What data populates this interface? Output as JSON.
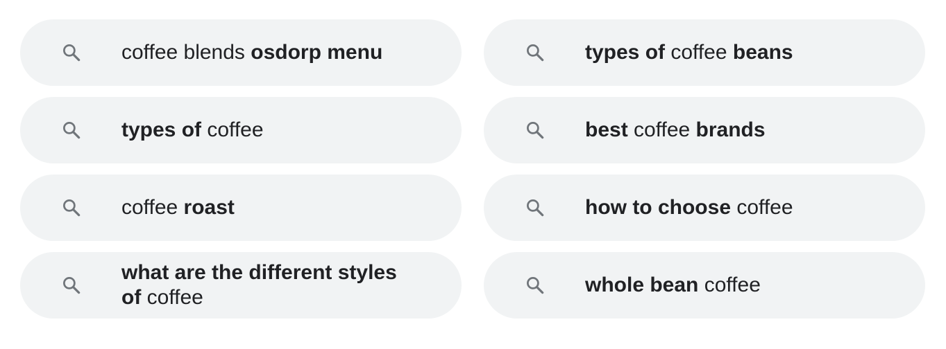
{
  "suggestions": [
    {
      "icon": "search-icon",
      "segments": [
        {
          "text": "coffee blends ",
          "bold": false
        },
        {
          "text": "osdorp menu",
          "bold": true
        }
      ]
    },
    {
      "icon": "search-icon",
      "segments": [
        {
          "text": "types of",
          "bold": true
        },
        {
          "text": " coffee ",
          "bold": false
        },
        {
          "text": "beans",
          "bold": true
        }
      ]
    },
    {
      "icon": "search-icon",
      "segments": [
        {
          "text": "types of",
          "bold": true
        },
        {
          "text": " coffee",
          "bold": false
        }
      ]
    },
    {
      "icon": "search-icon",
      "segments": [
        {
          "text": "best",
          "bold": true
        },
        {
          "text": " coffee ",
          "bold": false
        },
        {
          "text": "brands",
          "bold": true
        }
      ]
    },
    {
      "icon": "search-icon",
      "segments": [
        {
          "text": "coffee ",
          "bold": false
        },
        {
          "text": "roast",
          "bold": true
        }
      ]
    },
    {
      "icon": "search-icon",
      "segments": [
        {
          "text": "how to choose",
          "bold": true
        },
        {
          "text": " coffee",
          "bold": false
        }
      ]
    },
    {
      "icon": "search-icon",
      "segments": [
        {
          "text": "what are the different styles of",
          "bold": true
        },
        {
          "text": " coffee",
          "bold": false
        }
      ]
    },
    {
      "icon": "search-icon",
      "segments": [
        {
          "text": "whole bean",
          "bold": true
        },
        {
          "text": " coffee",
          "bold": false
        }
      ]
    }
  ],
  "colors": {
    "pill_background": "#f1f3f4",
    "text": "#202124",
    "icon": "#70757a"
  }
}
